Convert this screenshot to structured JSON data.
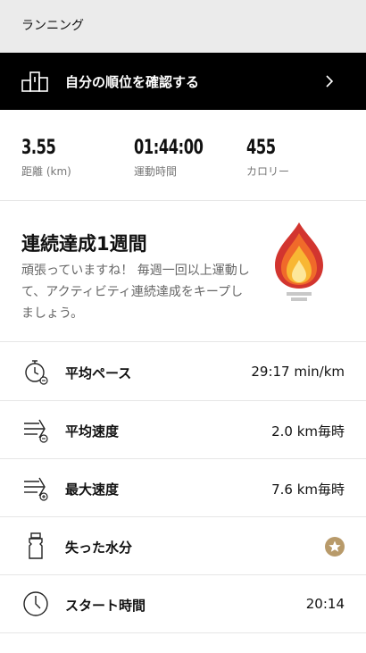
{
  "header": {
    "title": "ランニング"
  },
  "rank_banner": {
    "label": "自分の順位を確認する",
    "icon": "podium-icon",
    "chevron": "chevron-right-icon"
  },
  "stats": [
    {
      "value": "3.55",
      "label": "距離 (km)"
    },
    {
      "value": "01:44:00",
      "label": "運動時間"
    },
    {
      "value": "455",
      "label": "カロリー"
    }
  ],
  "streak": {
    "title": "連続達成1週間",
    "description": "頑張っていますね！ 毎週一回以上運動して、アクティビティ連続達成をキープしましょう。",
    "badge_icon": "flame-torch-icon",
    "colors": {
      "outer": "#d2352f",
      "middle": "#f06a2a",
      "inner": "#f8b733",
      "core": "#fde79a",
      "base": "#c8c8c8"
    }
  },
  "metrics": [
    {
      "label": "平均ペース",
      "value": "29:17 min/km",
      "icon": "stopwatch-icon"
    },
    {
      "label": "平均速度",
      "value": "2.0 km毎時",
      "icon": "speed-average-icon"
    },
    {
      "label": "最大速度",
      "value": "7.6 km毎時",
      "icon": "speed-max-icon"
    },
    {
      "label": "失った水分",
      "value": "",
      "icon": "water-bottle-icon",
      "badge": "star-icon"
    },
    {
      "label": "スタート時間",
      "value": "20:14",
      "icon": "clock-icon"
    }
  ]
}
